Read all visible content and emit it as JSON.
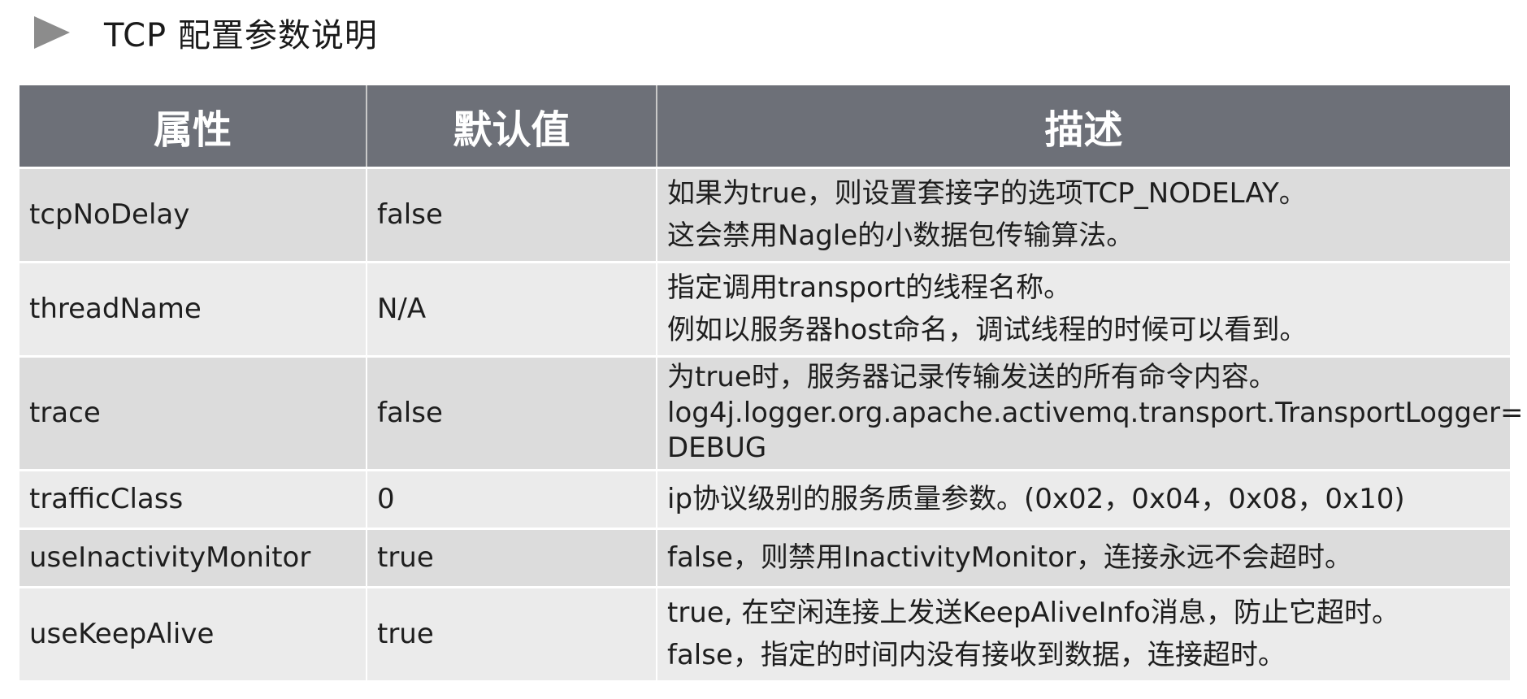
{
  "title": "TCP 配置参数说明",
  "table": {
    "headers": [
      "属性",
      "默认值",
      "描述"
    ],
    "rows": [
      {
        "property": "tcpNoDelay",
        "default": "false",
        "description": [
          "如果为true，则设置套接字的选项TCP_NODELAY。",
          "这会禁用Nagle的小数据包传输算法。"
        ]
      },
      {
        "property": "threadName",
        "default": "N/A",
        "description": [
          "指定调用transport的线程名称。",
          "例如以服务器host命名，调试线程的时候可以看到。"
        ]
      },
      {
        "property": "trace",
        "default": "false",
        "description": [
          "为true时，服务器记录传输发送的所有命令内容。",
          "log4j.logger.org.apache.activemq.transport.TransportLogger=",
          "DEBUG"
        ]
      },
      {
        "property": "trafficClass",
        "default": "0",
        "description": [
          "ip协议级别的服务质量参数。(0x02，0x04，0x08，0x10)"
        ]
      },
      {
        "property": "useInactivityMonitor",
        "default": "true",
        "description": [
          "false，则禁用InactivityMonitor，连接永远不会超时。"
        ]
      },
      {
        "property": "useKeepAlive",
        "default": "true",
        "description": [
          "true, 在空闲连接上发送KeepAliveInfo消息，防止它超时。",
          "false，指定的时间内没有接收到数据，连接超时。"
        ]
      }
    ]
  },
  "colors": {
    "header_bg": "#6d7078",
    "row_odd_bg": "#dcdcdc",
    "row_even_bg": "#ebebeb",
    "arrow": "#8c8c8c"
  },
  "icons": {
    "title_marker": "play-triangle-icon"
  }
}
